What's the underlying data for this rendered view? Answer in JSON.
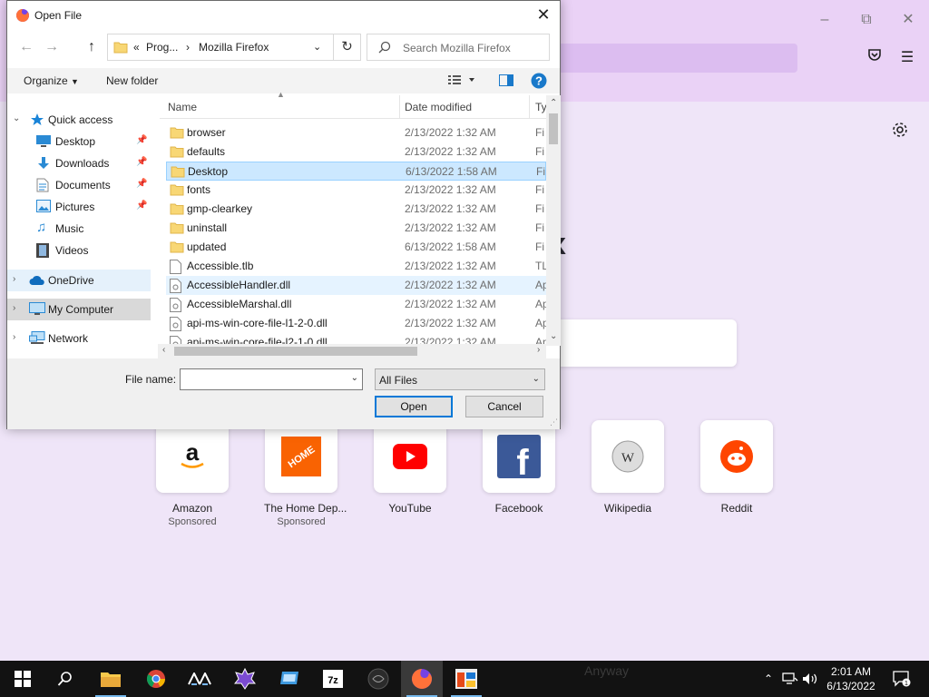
{
  "dialog": {
    "title": "Open File",
    "breadcrumb": {
      "prefix": "«",
      "parent": "Prog...",
      "separator": "›",
      "current": "Mozilla Firefox"
    },
    "search_placeholder": "Search Mozilla Firefox",
    "commands": {
      "organize": "Organize",
      "new_folder": "New folder"
    },
    "nav": [
      {
        "label": "Quick access",
        "name": "nav-quick-access",
        "icon": "star-icon",
        "expanded": true
      },
      {
        "label": "Desktop",
        "name": "nav-desktop",
        "icon": "desktop-icon",
        "pinned": true
      },
      {
        "label": "Downloads",
        "name": "nav-downloads",
        "icon": "downloads-icon",
        "pinned": true
      },
      {
        "label": "Documents",
        "name": "nav-documents",
        "icon": "documents-icon",
        "pinned": true
      },
      {
        "label": "Pictures",
        "name": "nav-pictures",
        "icon": "pictures-icon",
        "pinned": true
      },
      {
        "label": "Music",
        "name": "nav-music",
        "icon": "music-icon"
      },
      {
        "label": "Videos",
        "name": "nav-videos",
        "icon": "videos-icon"
      },
      {
        "label": "OneDrive",
        "name": "nav-onedrive",
        "icon": "cloud-icon"
      },
      {
        "label": "My Computer",
        "name": "nav-my-computer",
        "icon": "computer-icon"
      },
      {
        "label": "Network",
        "name": "nav-network",
        "icon": "network-icon"
      }
    ],
    "columns": {
      "name": "Name",
      "date": "Date modified",
      "type": "Ty"
    },
    "files": [
      {
        "name": "browser",
        "date": "2/13/2022 1:32 AM",
        "type": "Fi",
        "kind": "folder"
      },
      {
        "name": "defaults",
        "date": "2/13/2022 1:32 AM",
        "type": "Fi",
        "kind": "folder"
      },
      {
        "name": "Desktop",
        "date": "6/13/2022 1:58 AM",
        "type": "Fi",
        "kind": "folder",
        "state": "selected"
      },
      {
        "name": "fonts",
        "date": "2/13/2022 1:32 AM",
        "type": "Fi",
        "kind": "folder"
      },
      {
        "name": "gmp-clearkey",
        "date": "2/13/2022 1:32 AM",
        "type": "Fi",
        "kind": "folder"
      },
      {
        "name": "uninstall",
        "date": "2/13/2022 1:32 AM",
        "type": "Fi",
        "kind": "folder"
      },
      {
        "name": "updated",
        "date": "6/13/2022 1:58 AM",
        "type": "Fi",
        "kind": "folder"
      },
      {
        "name": "Accessible.tlb",
        "date": "2/13/2022 1:32 AM",
        "type": "TL",
        "kind": "file"
      },
      {
        "name": "AccessibleHandler.dll",
        "date": "2/13/2022 1:32 AM",
        "type": "Ap",
        "kind": "dll",
        "state": "hover"
      },
      {
        "name": "AccessibleMarshal.dll",
        "date": "2/13/2022 1:32 AM",
        "type": "Ap",
        "kind": "dll"
      },
      {
        "name": "api-ms-win-core-file-l1-2-0.dll",
        "date": "2/13/2022 1:32 AM",
        "type": "Ap",
        "kind": "dll"
      },
      {
        "name": "api-ms-win-core-file-l2-1-0.dll",
        "date": "2/13/2022 1:32 AM",
        "type": "Ap",
        "kind": "dll"
      }
    ],
    "filename_label": "File name:",
    "filename_value": "",
    "filetype_value": "All Files",
    "open_label": "Open",
    "cancel_label": "Cancel"
  },
  "firefox": {
    "logo_fragment": "x",
    "shortcuts": [
      {
        "label": "Amazon",
        "sub": "Sponsored",
        "icon": "amazon-icon"
      },
      {
        "label": "The Home Dep...",
        "sub": "Sponsored",
        "icon": "home-depot-icon"
      },
      {
        "label": "YouTube",
        "sub": "",
        "icon": "youtube-icon"
      },
      {
        "label": "Facebook",
        "sub": "",
        "icon": "facebook-icon"
      },
      {
        "label": "Wikipedia",
        "sub": "",
        "icon": "wikipedia-icon"
      },
      {
        "label": "Reddit",
        "sub": "",
        "icon": "reddit-icon"
      }
    ]
  },
  "taskbar": {
    "items": [
      "start-icon",
      "search-icon",
      "file-explorer-icon",
      "chrome-icon",
      "app-icon",
      "game-icon",
      "remote-desktop-icon",
      "7zip-icon",
      "media-icon",
      "firefox-icon",
      "app-window-icon"
    ],
    "active": "firefox-icon",
    "clock_time": "2:01 AM",
    "clock_date": "6/13/2022",
    "notification_count": "1",
    "ghost_text": "Anyway"
  },
  "colors": {
    "accent": "#0078d7",
    "selection": "#cce8ff",
    "firefox_bg": "#efe5f8",
    "firefox_toolbar": "#ead2f6",
    "taskbar": "#121212"
  }
}
